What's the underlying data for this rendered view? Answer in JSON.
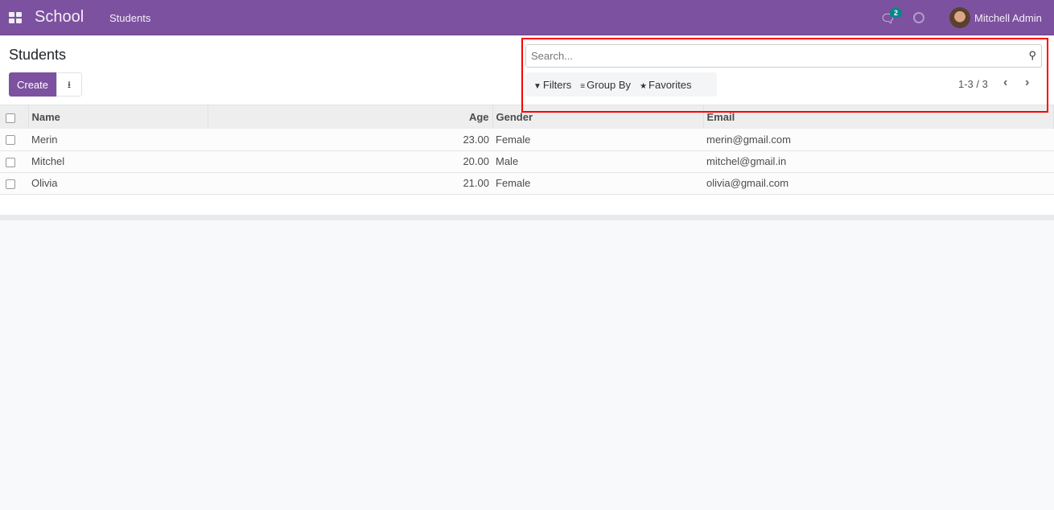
{
  "navbar": {
    "app_name": "School",
    "menu": "Students",
    "chat_badge": "2",
    "user": "Mitchell Admin",
    "color": "#7c519f"
  },
  "control_panel": {
    "title": "Students",
    "create_label": "Create",
    "search_placeholder": "Search...",
    "filters": "Filters",
    "group_by": "Group By",
    "favorites": "Favorites",
    "pager": "1-3 / 3"
  },
  "table": {
    "headers": {
      "name": "Name",
      "age": "Age",
      "gender": "Gender",
      "email": "Email"
    },
    "rows": [
      {
        "name": "Merin",
        "age": "23.00",
        "gender": "Female",
        "email": "merin@gmail.com"
      },
      {
        "name": "Mitchel",
        "age": "20.00",
        "gender": "Male",
        "email": "mitchel@gmail.in"
      },
      {
        "name": "Olivia",
        "age": "21.00",
        "gender": "Female",
        "email": "olivia@gmail.com"
      }
    ]
  },
  "highlight_color": "#ff0000"
}
